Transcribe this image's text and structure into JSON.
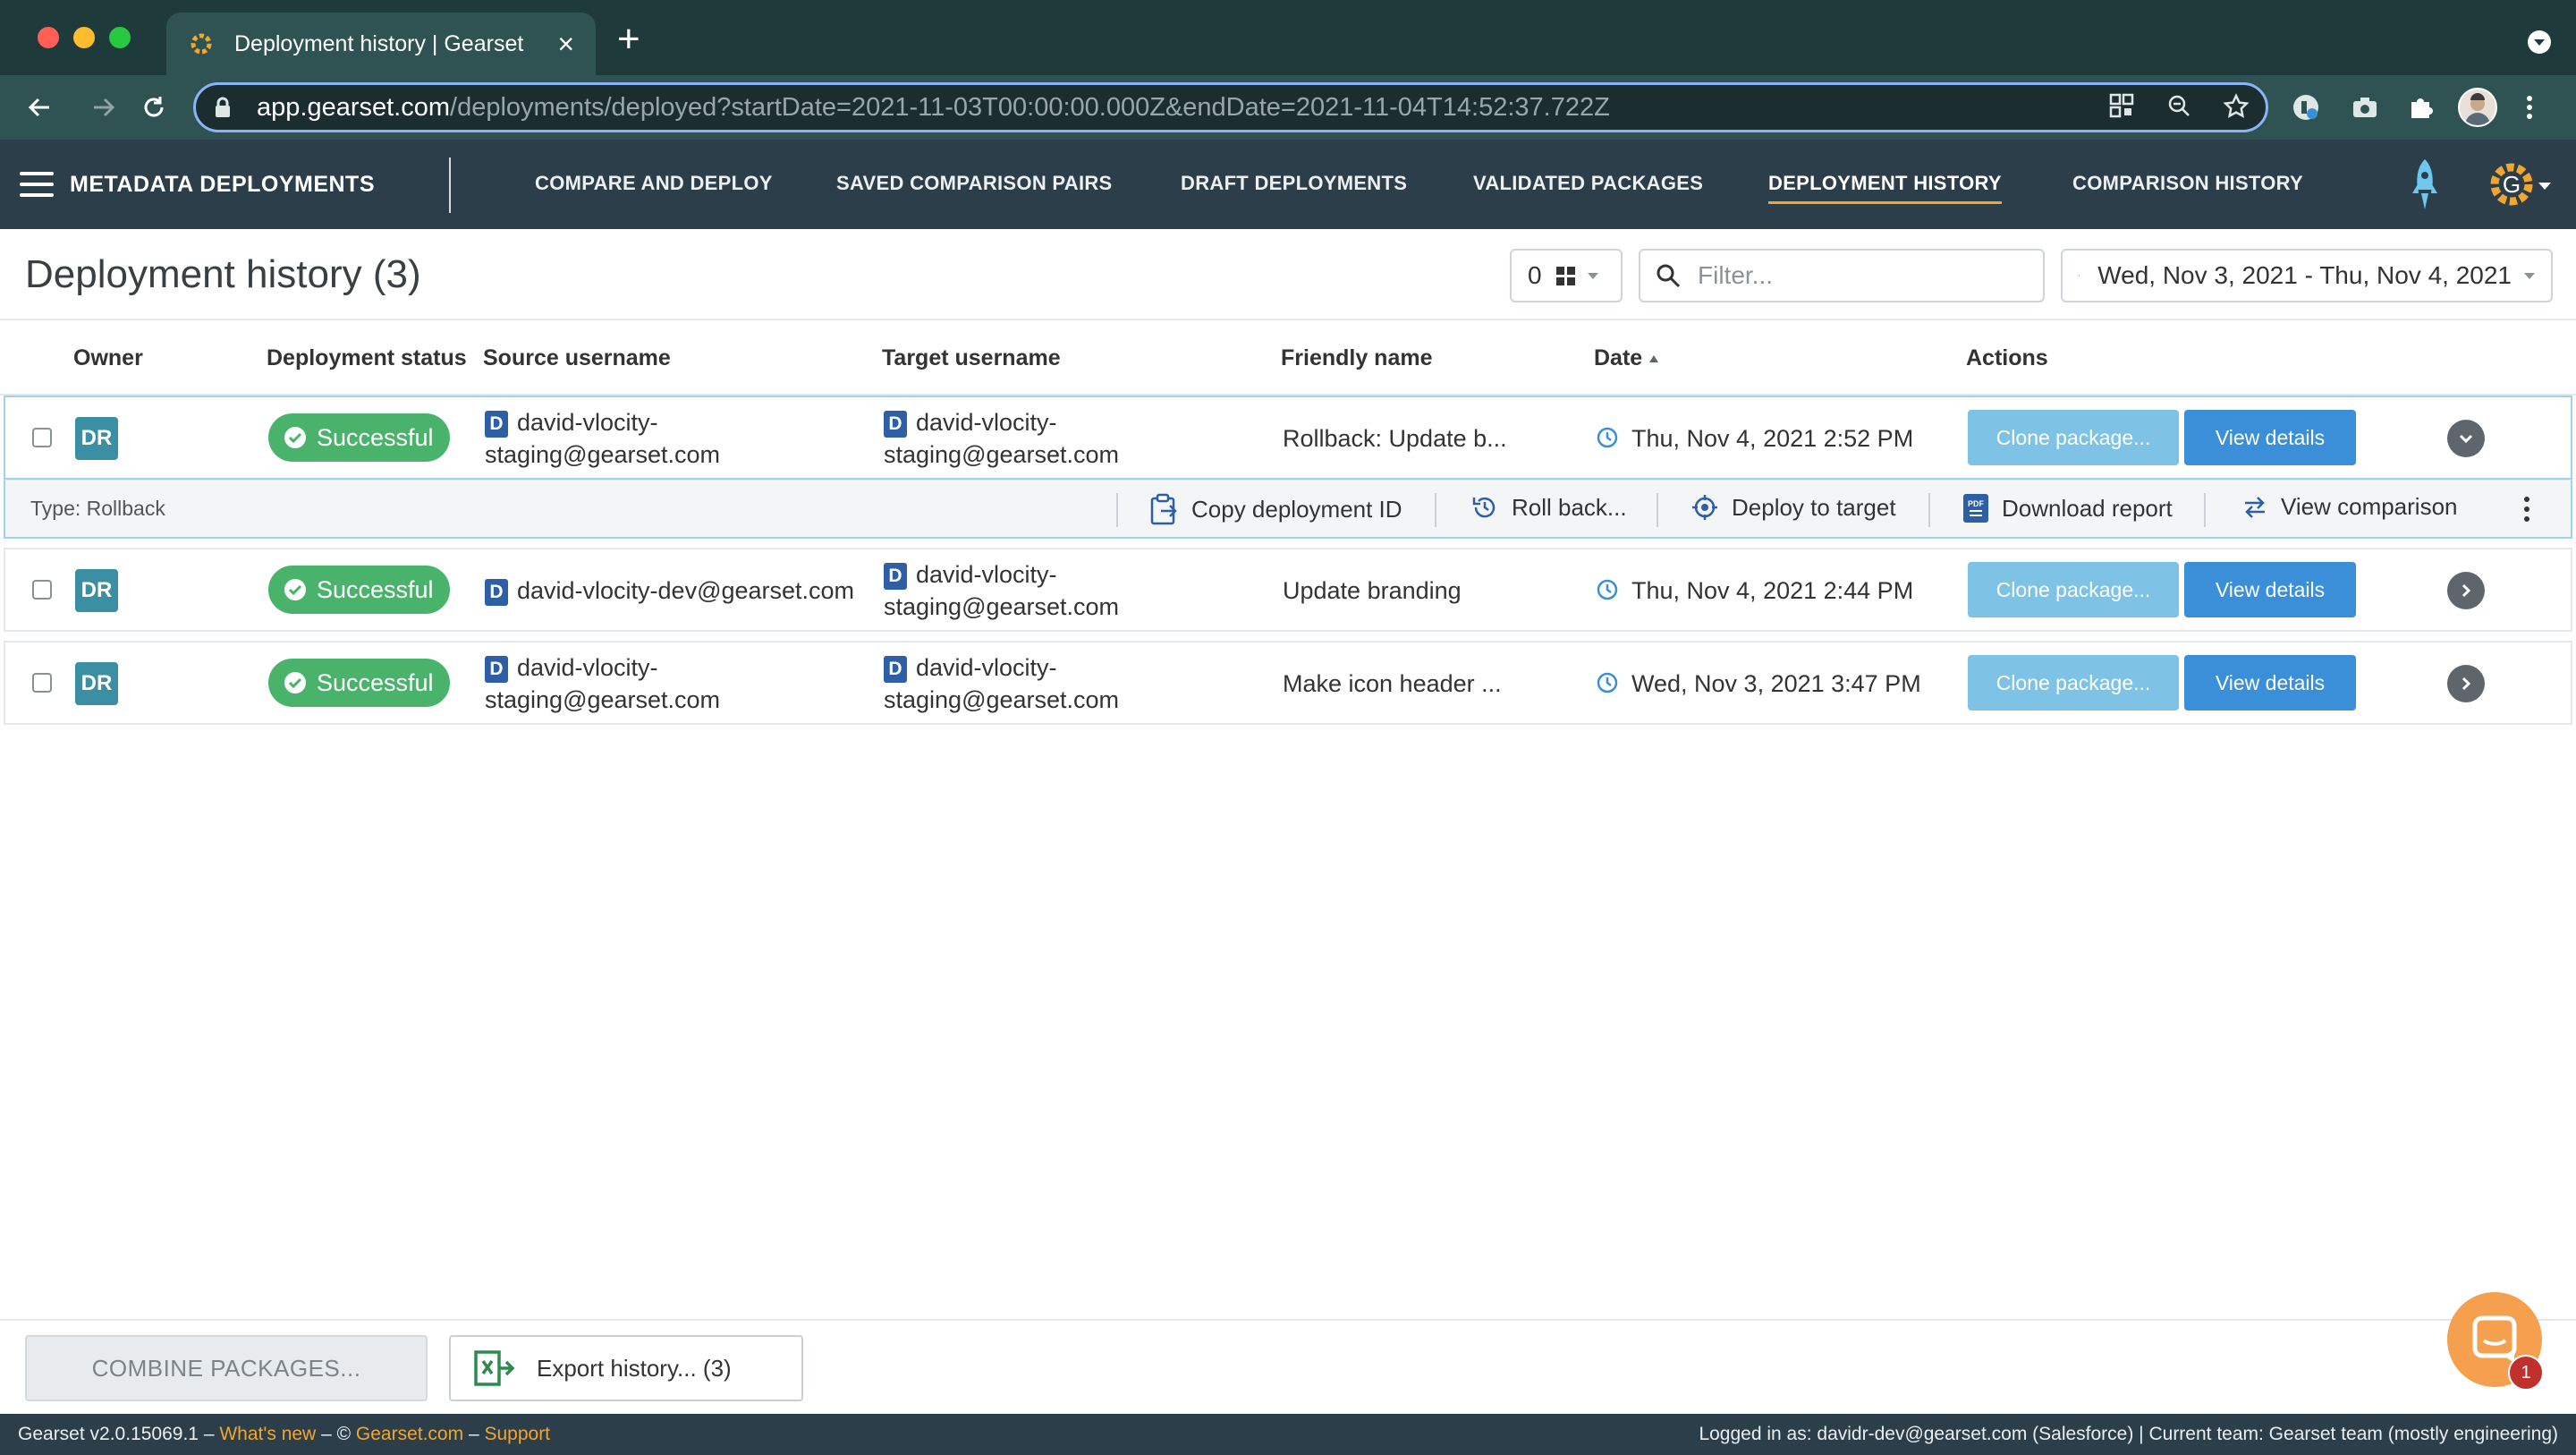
{
  "browser": {
    "tab_title": "Deployment history | Gearset",
    "new_tab_label": "+",
    "url_host": "app.gearset.com",
    "url_path": "/deployments/deployed?startDate=2021-11-03T00:00:00.000Z&endDate=2021-11-04T14:52:37.722Z"
  },
  "appnav": {
    "title": "METADATA DEPLOYMENTS",
    "links": [
      "COMPARE AND DEPLOY",
      "SAVED COMPARISON PAIRS",
      "DRAFT DEPLOYMENTS",
      "VALIDATED PACKAGES",
      "DEPLOYMENT HISTORY",
      "COMPARISON HISTORY"
    ],
    "active_link": "DEPLOYMENT HISTORY",
    "accent_color": "#f0a630",
    "user_initial": "G"
  },
  "header": {
    "title": "Deployment history (3)",
    "selected_count": "0",
    "filter_placeholder": "Filter...",
    "date_range": "Wed, Nov 3, 2021 - Thu, Nov 4, 2021"
  },
  "table": {
    "columns": [
      "Owner",
      "Deployment status",
      "Source username",
      "Target username",
      "Friendly name",
      "Date",
      "Actions"
    ],
    "sort_column": "Date",
    "sort_direction": "ascending",
    "rows": [
      {
        "owner": "DR",
        "status": "Successful",
        "org_badge": "D",
        "source_line1": "david-vlocity-",
        "source_line2": "staging@gearset.com",
        "target_line1": "david-vlocity-",
        "target_line2": "staging@gearset.com",
        "friendly_name": "Rollback: Update b...",
        "date": "Thu, Nov 4, 2021 2:52 PM",
        "clone_label": "Clone package...",
        "view_label": "View details",
        "expanded": true
      },
      {
        "owner": "DR",
        "status": "Successful",
        "org_badge": "D",
        "source_line1": "david-vlocity-dev@gearset.com",
        "source_line2": "",
        "target_line1": "david-vlocity-",
        "target_line2": "staging@gearset.com",
        "friendly_name": "Update branding",
        "date": "Thu, Nov 4, 2021 2:44 PM",
        "clone_label": "Clone package...",
        "view_label": "View details",
        "expanded": false
      },
      {
        "owner": "DR",
        "status": "Successful",
        "org_badge": "D",
        "source_line1": "david-vlocity-",
        "source_line2": "staging@gearset.com",
        "target_line1": "david-vlocity-",
        "target_line2": "staging@gearset.com",
        "friendly_name": "Make icon header ...",
        "date": "Wed, Nov 3, 2021 3:47 PM",
        "clone_label": "Clone package...",
        "view_label": "View details",
        "expanded": false
      }
    ],
    "expanded_detail": {
      "type_label": "Type: Rollback",
      "actions": [
        "Copy deployment ID",
        "Roll back...",
        "Deploy to target",
        "Download report",
        "View comparison"
      ],
      "pdf_label": "PDF"
    }
  },
  "footer": {
    "combine_label": "COMBINE PACKAGES...",
    "export_label": "Export history... (3)",
    "chat_badge": "1"
  },
  "statusbar": {
    "version": "Gearset v2.0.15069.1",
    "sep1": " – ",
    "whats_new": "What's new",
    "sep2": " – © ",
    "gearset_link": "Gearset.com",
    "sep3": " – ",
    "support": "Support",
    "right_text": "Logged in as: davidr-dev@gearset.com (Salesforce) | Current team: Gearset team (mostly engineering)"
  },
  "colors": {
    "success_green": "#49b36b",
    "primary_blue": "#3b8fd9",
    "light_blue": "#7ec3e5",
    "nav_bg": "#2c3e4a"
  }
}
